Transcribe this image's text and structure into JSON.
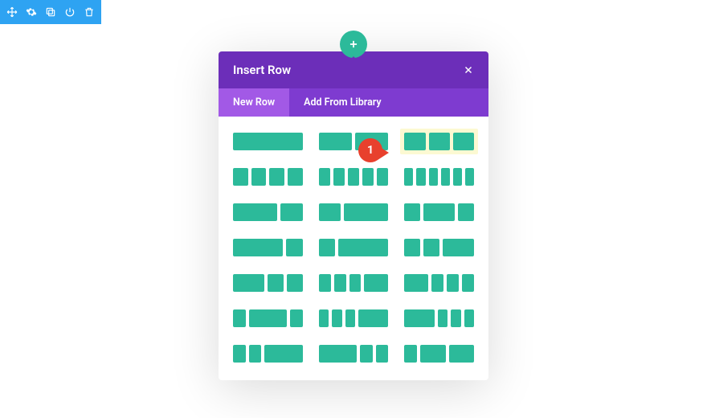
{
  "toolbar": {
    "icons": [
      "move-icon",
      "gear-icon",
      "duplicate-icon",
      "power-icon",
      "trash-icon"
    ]
  },
  "add_button": {
    "label": "+"
  },
  "modal": {
    "title": "Insert Row",
    "close_label": "×",
    "tabs": [
      {
        "label": "New Row",
        "active": true
      },
      {
        "label": "Add From Library",
        "active": false
      }
    ],
    "layouts": [
      {
        "cols": [
          1
        ]
      },
      {
        "cols": [
          1,
          1
        ]
      },
      {
        "cols": [
          1,
          1,
          1
        ],
        "highlight": true
      },
      {
        "cols": [
          1,
          1,
          1,
          1
        ]
      },
      {
        "cols": [
          1,
          1,
          1,
          1,
          1
        ]
      },
      {
        "cols": [
          1,
          1,
          1,
          1,
          1,
          1
        ]
      },
      {
        "cols": [
          2,
          1
        ]
      },
      {
        "cols": [
          1,
          2
        ]
      },
      {
        "cols": [
          1,
          2,
          1
        ]
      },
      {
        "cols": [
          3,
          1
        ]
      },
      {
        "cols": [
          1,
          3
        ]
      },
      {
        "cols": [
          1,
          1,
          2
        ]
      },
      {
        "cols": [
          2,
          1,
          1
        ]
      },
      {
        "cols": [
          1,
          1,
          1,
          2
        ]
      },
      {
        "cols": [
          2,
          1,
          1,
          1
        ]
      },
      {
        "cols": [
          1,
          3,
          1
        ]
      },
      {
        "cols": [
          1,
          1,
          1,
          3
        ]
      },
      {
        "cols": [
          3,
          1,
          1,
          1
        ]
      },
      {
        "cols": [
          1,
          1,
          3
        ]
      },
      {
        "cols": [
          3,
          1,
          1
        ]
      },
      {
        "cols": [
          1,
          2,
          2
        ]
      }
    ]
  },
  "callout": {
    "number": "1"
  }
}
